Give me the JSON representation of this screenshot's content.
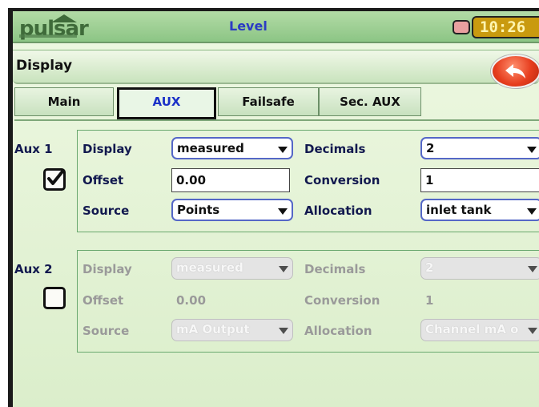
{
  "topbar": {
    "brand": "pulsar",
    "screen_title": "Level",
    "clock": "10:26"
  },
  "header": {
    "title": "Display"
  },
  "tabs": [
    {
      "label": "Main"
    },
    {
      "label": "AUX"
    },
    {
      "label": "Failsafe"
    },
    {
      "label": "Sec. AUX"
    }
  ],
  "aux1": {
    "label": "Aux 1",
    "checked": true,
    "display_label": "Display",
    "display_value": "measured",
    "offset_label": "Offset",
    "offset_value": "0.00",
    "source_label": "Source",
    "source_value": "Points",
    "decimals_label": "Decimals",
    "decimals_value": "2",
    "conversion_label": "Conversion",
    "conversion_value": "1",
    "allocation_label": "Allocation",
    "allocation_value": "inlet tank"
  },
  "aux2": {
    "label": "Aux 2",
    "checked": false,
    "display_label": "Display",
    "display_value": "measured",
    "offset_label": "Offset",
    "offset_value": "0.00",
    "source_label": "Source",
    "source_value": "mA Output",
    "decimals_label": "Decimals",
    "decimals_value": "2",
    "conversion_label": "Conversion",
    "conversion_value": "1",
    "allocation_label": "Allocation",
    "allocation_value": "Channel mA o"
  },
  "colors": {
    "accent": "#1b31c7",
    "label_dark": "#12194f",
    "panel_border": "#69a86e",
    "back_button": "#e63d1e"
  }
}
